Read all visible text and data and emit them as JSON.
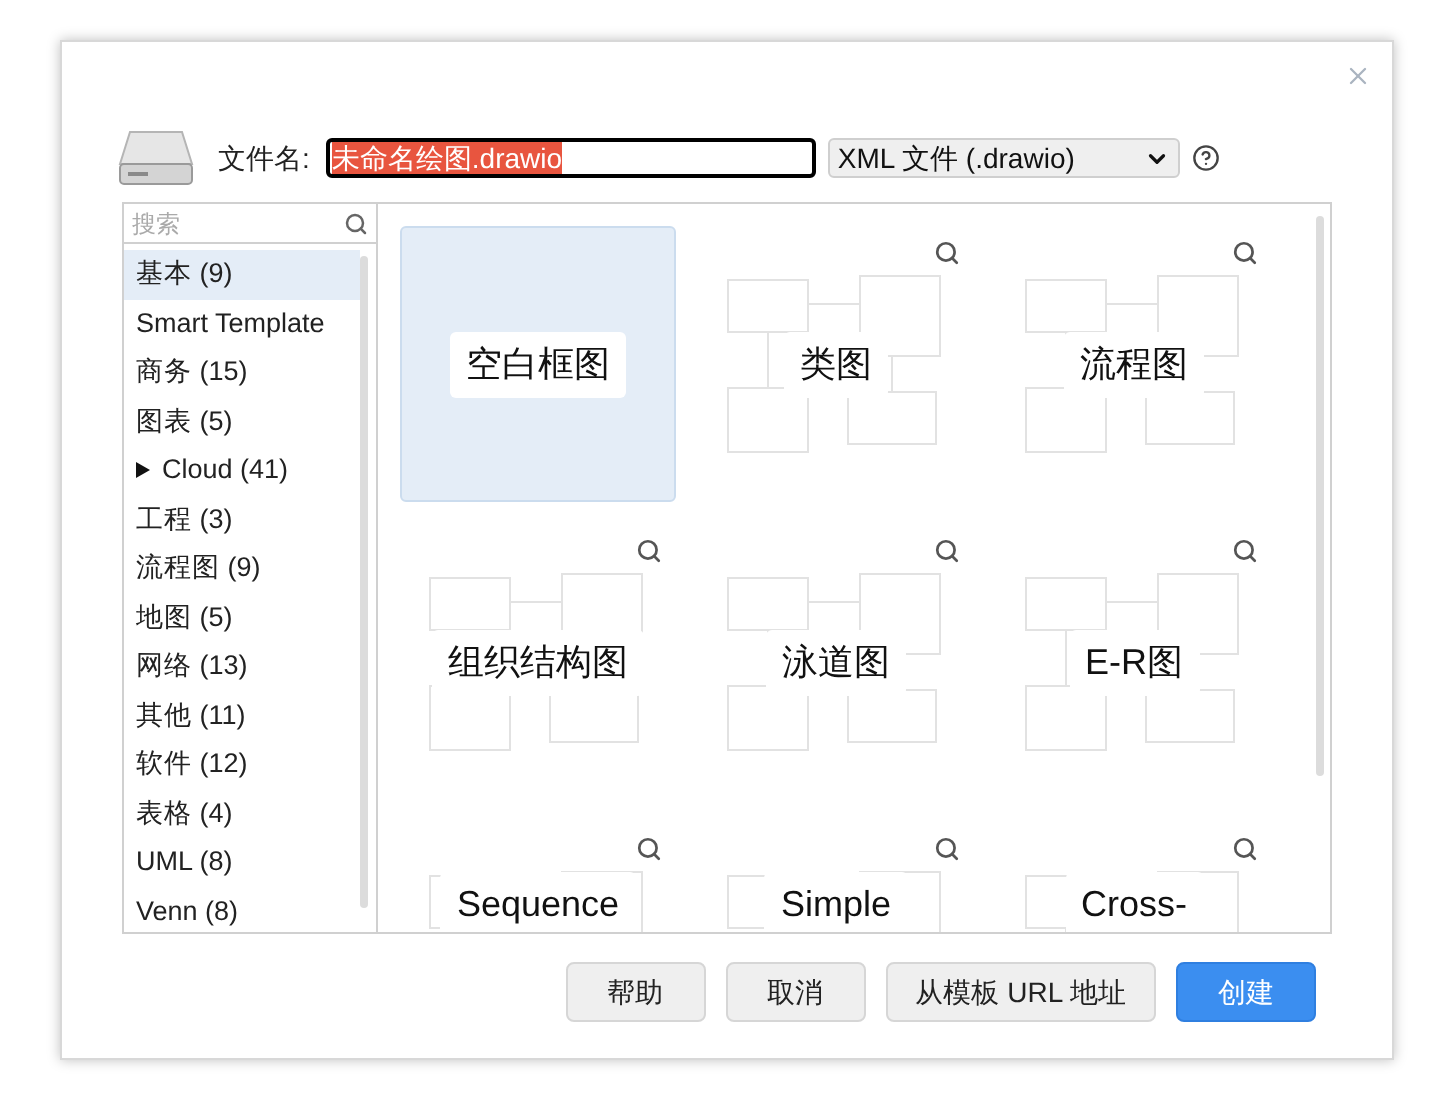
{
  "file_name": {
    "label": "文件名:",
    "value": "未命名绘图.drawio",
    "selected": true
  },
  "format_select": {
    "value": "XML 文件 (.drawio)"
  },
  "sidebar": {
    "search": {
      "placeholder": "搜索"
    },
    "items": [
      {
        "kind": "category",
        "label": "基本 (9)",
        "selected": true
      },
      {
        "kind": "category",
        "label": "Smart Template",
        "selected": false
      },
      {
        "kind": "category",
        "label": "商务 (15)",
        "selected": false
      },
      {
        "kind": "category",
        "label": "图表 (5)",
        "selected": false
      },
      {
        "kind": "group",
        "label": "Cloud (41)",
        "selected": false,
        "expanded": false
      },
      {
        "kind": "category",
        "label": "工程 (3)",
        "selected": false
      },
      {
        "kind": "category",
        "label": "流程图 (9)",
        "selected": false
      },
      {
        "kind": "category",
        "label": "地图 (5)",
        "selected": false
      },
      {
        "kind": "category",
        "label": "网络 (13)",
        "selected": false
      },
      {
        "kind": "category",
        "label": "其他 (11)",
        "selected": false
      },
      {
        "kind": "category",
        "label": "软件 (12)",
        "selected": false
      },
      {
        "kind": "category",
        "label": "表格 (4)",
        "selected": false
      },
      {
        "kind": "category",
        "label": "UML (8)",
        "selected": false
      },
      {
        "kind": "category",
        "label": "Venn (8)",
        "selected": false
      }
    ]
  },
  "templates": [
    {
      "kind": "blank",
      "label": "空白框图",
      "selected": true
    },
    {
      "kind": "template",
      "label": "类图",
      "selected": false
    },
    {
      "kind": "template",
      "label": "流程图",
      "selected": false
    },
    {
      "kind": "template",
      "label": "组织结构图",
      "selected": false
    },
    {
      "kind": "template",
      "label": "泳道图",
      "selected": false
    },
    {
      "kind": "template",
      "label": "E-R图",
      "selected": false
    },
    {
      "kind": "template",
      "label": "Sequence",
      "selected": false
    },
    {
      "kind": "template",
      "label": "Simple",
      "selected": false
    },
    {
      "kind": "template",
      "label": "Cross-",
      "selected": false
    }
  ],
  "buttons": [
    {
      "kind": "normal",
      "label": "帮助"
    },
    {
      "kind": "normal",
      "label": "取消"
    },
    {
      "kind": "normal",
      "label": "从模板 URL 地址"
    },
    {
      "kind": "primary",
      "label": "创建"
    }
  ]
}
